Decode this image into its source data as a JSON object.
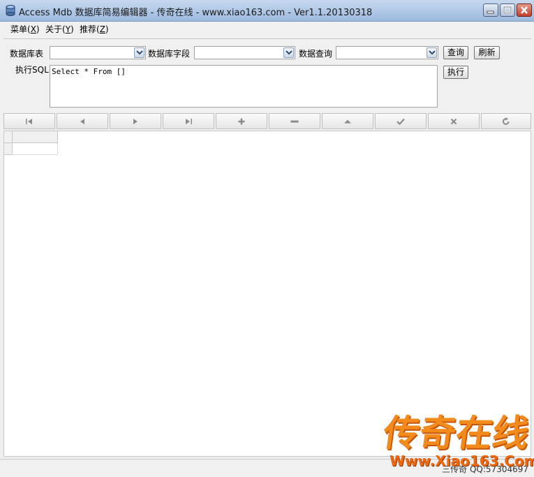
{
  "window": {
    "title": "Access Mdb 数据库简易编辑器 - 传奇在线 - www.xiao163.com - Ver1.1.20130318",
    "icons": {
      "app": "database-icon",
      "minimize": "minimize-icon",
      "maximize": "maximize-icon",
      "close": "close-icon"
    }
  },
  "menu": {
    "items": [
      {
        "label": "菜单(",
        "key": "X",
        "suffix": ")"
      },
      {
        "label": "关于(",
        "key": "Y",
        "suffix": ")"
      },
      {
        "label": "推荐(",
        "key": "Z",
        "suffix": ")"
      }
    ]
  },
  "query": {
    "table_label": "数据库表",
    "table_value": "",
    "field_label": "数据库字段",
    "field_value": "",
    "query_label": "数据查询",
    "query_value": "",
    "search_button": "查询",
    "refresh_button": "刷新",
    "sql_label": "执行SQL",
    "sql_value": "Select * From []",
    "execute_button": "执行"
  },
  "navigator": {
    "buttons": [
      "first-icon",
      "prior-icon",
      "next-icon",
      "last-icon",
      "insert-icon",
      "delete-icon",
      "edit-icon",
      "post-icon",
      "cancel-icon",
      "refresh-icon"
    ]
  },
  "status": {
    "text": "三传奇 QQ:57304697"
  },
  "watermark": {
    "brand": "传奇在线",
    "url": "Www.Xiao163.Com"
  },
  "colors": {
    "titlebar": "#9cb9de",
    "watermark": "#f28b1c",
    "close_button": "#c3402b"
  }
}
